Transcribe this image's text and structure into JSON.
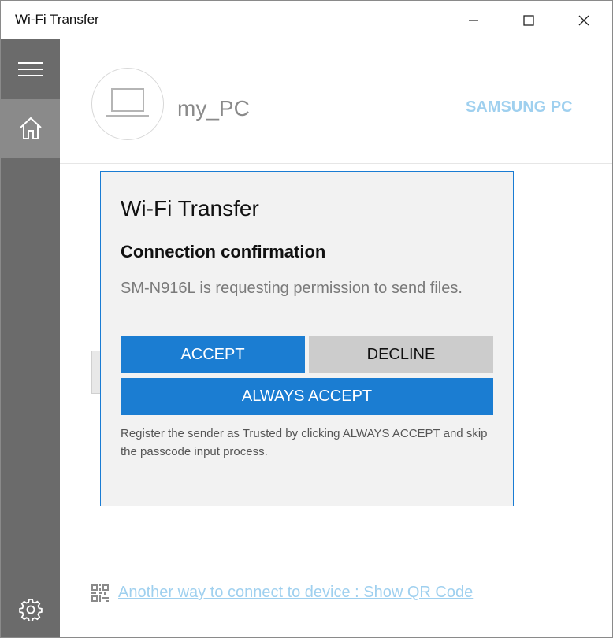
{
  "window": {
    "title": "Wi-Fi Transfer",
    "controls": [
      "minimize",
      "maximize",
      "close"
    ]
  },
  "sidebar": {
    "items": [
      {
        "name": "menu",
        "icon": "hamburger-icon"
      },
      {
        "name": "home",
        "icon": "home-icon",
        "selected": true
      },
      {
        "name": "settings",
        "icon": "gear-icon"
      }
    ]
  },
  "main": {
    "device_name": "my_PC",
    "device_type": "SAMSUNG PC",
    "qr_link": "Another way to connect to device : Show QR Code"
  },
  "dialog": {
    "title": "Wi-Fi Transfer",
    "heading": "Connection confirmation",
    "message": "SM-N916L is requesting permission to send files.",
    "accept_label": "ACCEPT",
    "decline_label": "DECLINE",
    "always_accept_label": "ALWAYS ACCEPT",
    "note": "Register the sender as Trusted by clicking ALWAYS ACCEPT and skip the passcode input process."
  },
  "colors": {
    "accent": "#1b7dd2",
    "sidebar": "#6b6b6b",
    "sidebar_selected": "#8a8a8a",
    "link": "#9fd0ef"
  }
}
